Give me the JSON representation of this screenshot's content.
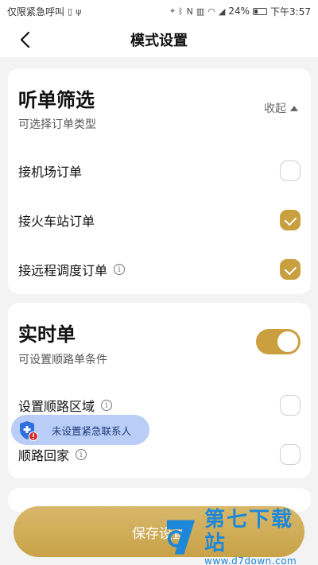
{
  "status_bar": {
    "carrier": "仅限紧急呼叫",
    "battery": "24%",
    "time": "下午3:57"
  },
  "navbar": {
    "title": "模式设置"
  },
  "filter_section": {
    "title": "听单筛选",
    "subtitle": "可选择订单类型",
    "collapse_label": "收起",
    "options": [
      {
        "label": "接机场订单",
        "checked": false
      },
      {
        "label": "接火车站订单",
        "checked": true
      },
      {
        "label": "接远程调度订单",
        "checked": true,
        "info": true
      }
    ]
  },
  "realtime_section": {
    "title": "实时单",
    "subtitle": "可设置顺路单条件",
    "enabled": true,
    "options": [
      {
        "label": "设置顺路区域",
        "checked": false,
        "info": true
      },
      {
        "label": "顺路回家",
        "checked": false,
        "info": true
      }
    ]
  },
  "toast": {
    "text": "未设置紧急联系人"
  },
  "save_button": {
    "label": "保存设置"
  },
  "watermark": {
    "name": "第七下载站",
    "url": "www.d7down.com"
  },
  "colors": {
    "accent": "#c99f3f",
    "toast_bg": "#b9cdf6",
    "watermark": "#1d88d8"
  }
}
